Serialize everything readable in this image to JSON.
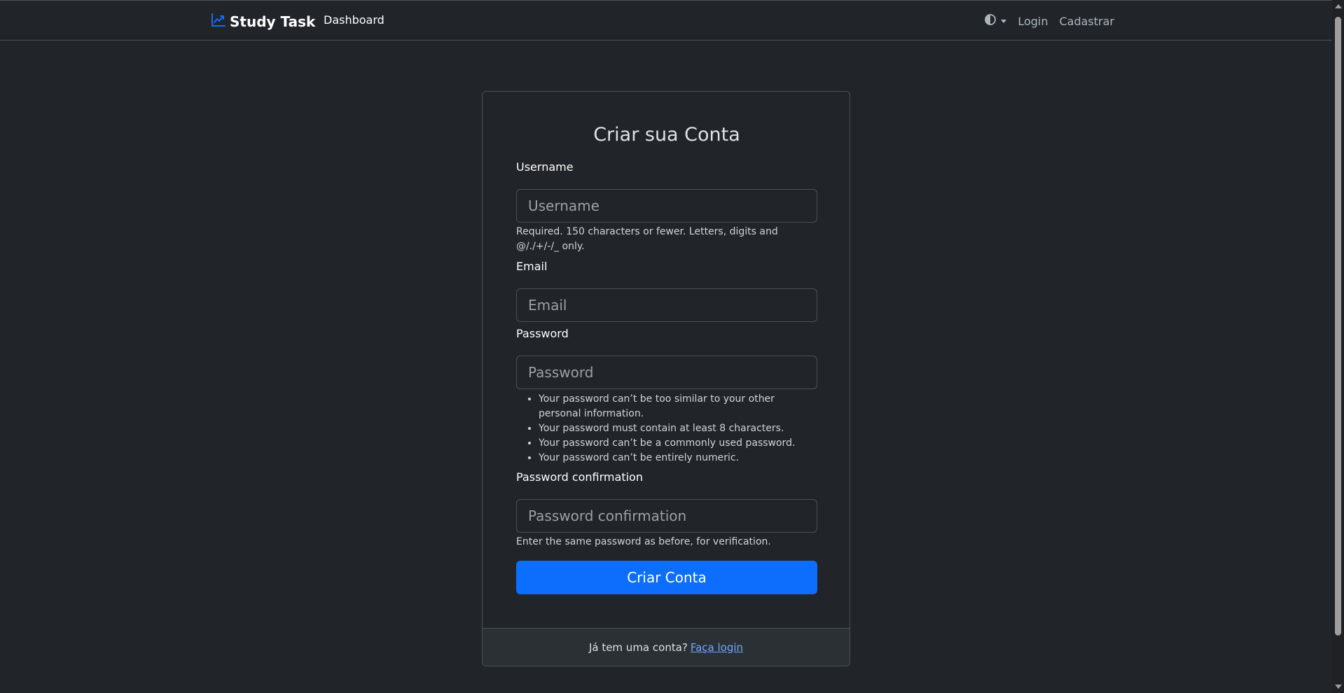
{
  "navbar": {
    "brand": "Study Task",
    "dashboard": "Dashboard",
    "login": "Login",
    "register": "Cadastrar",
    "brand_color": "#0d6efd"
  },
  "form": {
    "title": "Criar sua Conta",
    "username": {
      "label": "Username",
      "placeholder": "Username",
      "value": "",
      "help": "Required. 150 characters or fewer. Letters, digits and @/./+/-/_ only."
    },
    "email": {
      "label": "Email",
      "placeholder": "Email",
      "value": ""
    },
    "password": {
      "label": "Password",
      "placeholder": "Password",
      "value": "",
      "rules": [
        "Your password can’t be too similar to your other personal information.",
        "Your password must contain at least 8 characters.",
        "Your password can’t be a commonly used password.",
        "Your password can’t be entirely numeric."
      ]
    },
    "password_confirmation": {
      "label": "Password confirmation",
      "placeholder": "Password confirmation",
      "value": "",
      "help": "Enter the same password as before, for verification."
    },
    "submit": "Criar Conta"
  },
  "footer": {
    "question": "Já tem uma conta?",
    "link": "Faça login"
  },
  "colors": {
    "background": "#212529",
    "primary": "#0d6efd",
    "link": "#6ea8fe"
  }
}
